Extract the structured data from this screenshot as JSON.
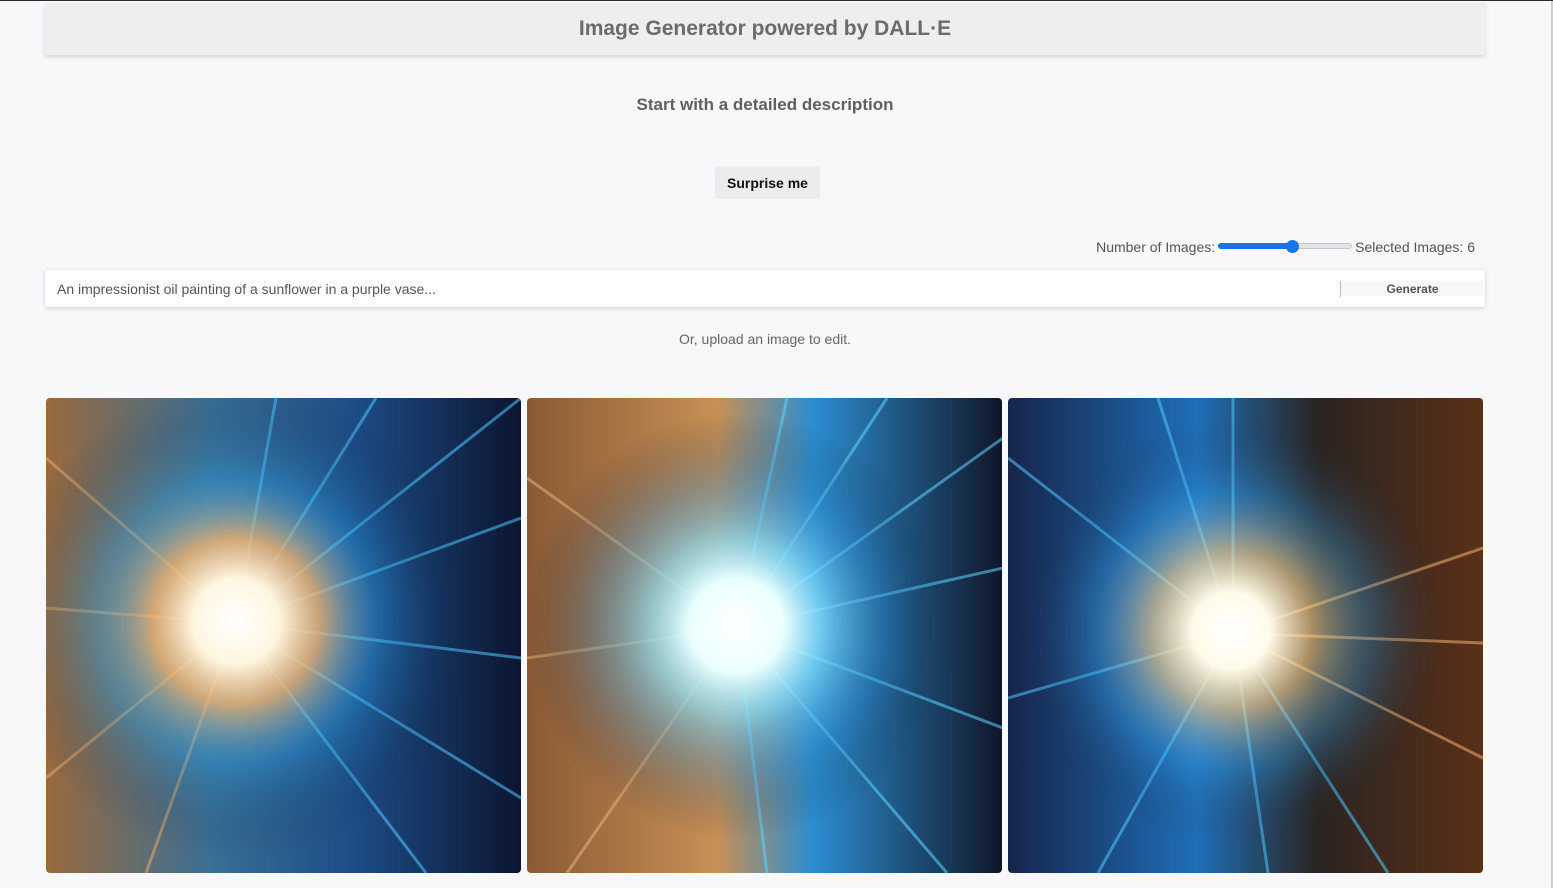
{
  "header": {
    "title": "Image Generator powered by DALL·E"
  },
  "intro": {
    "subtitle": "Start with a detailed description",
    "surprise_label": "Surprise me"
  },
  "controls": {
    "number_label": "Number of Images:",
    "slider_value": 6,
    "slider_min": 1,
    "slider_max": 10,
    "selected_label": "Selected Images: 6"
  },
  "prompt": {
    "placeholder": "An impressionist oil painting of a sunflower in a purple vase...",
    "value": "",
    "generate_label": "Generate"
  },
  "upload": {
    "label": "Or, upload an image to edit."
  },
  "gallery": {
    "images": [
      {
        "name": "generated-image-1"
      },
      {
        "name": "generated-image-2"
      },
      {
        "name": "generated-image-3"
      }
    ]
  },
  "colors": {
    "accent": "#1a73e8",
    "background": "#f8f8fa",
    "header_bg": "#eeeeef"
  }
}
